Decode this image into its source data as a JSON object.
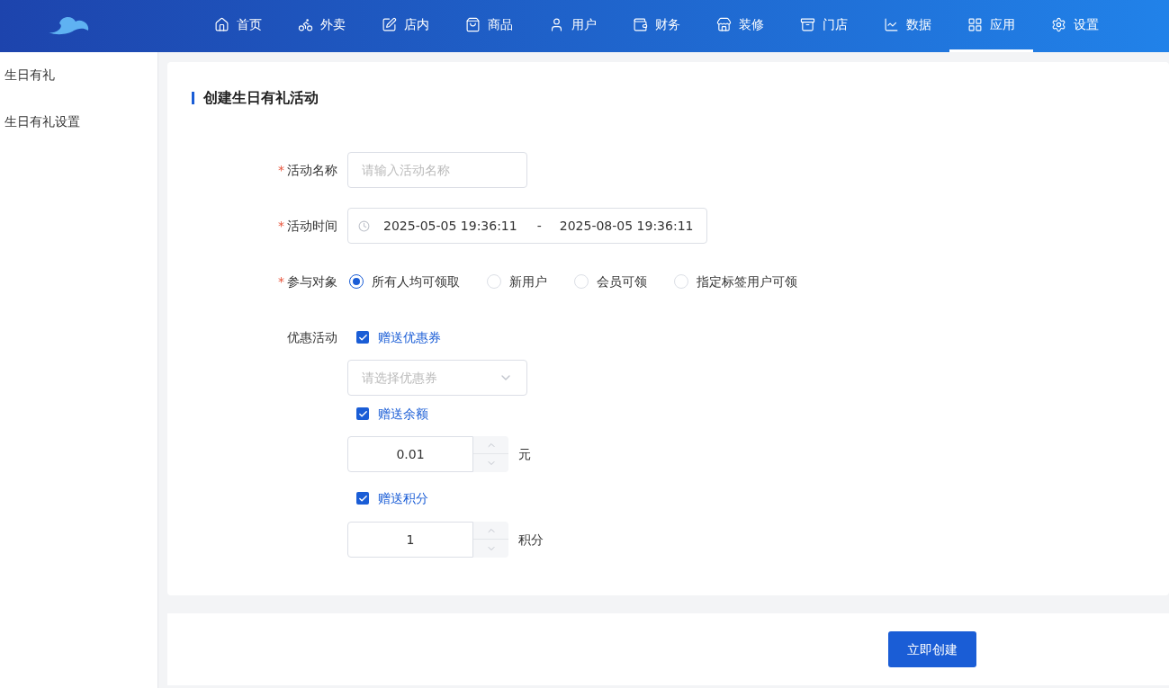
{
  "nav": {
    "items": [
      {
        "label": "首页",
        "selected": false
      },
      {
        "label": "外卖",
        "selected": false
      },
      {
        "label": "店内",
        "selected": false
      },
      {
        "label": "商品",
        "selected": false
      },
      {
        "label": "用户",
        "selected": false
      },
      {
        "label": "财务",
        "selected": false
      },
      {
        "label": "装修",
        "selected": false
      },
      {
        "label": "门店",
        "selected": false
      },
      {
        "label": "数据",
        "selected": false
      },
      {
        "label": "应用",
        "selected": true
      },
      {
        "label": "设置",
        "selected": false
      }
    ]
  },
  "sidebar": {
    "items": [
      {
        "label": "生日有礼"
      },
      {
        "label": "生日有礼设置"
      }
    ]
  },
  "form": {
    "title": "创建生日有礼活动",
    "fields": [
      {
        "kind": "text",
        "required_mark": "*",
        "label": "活动名称",
        "placeholder": "请输入活动名称"
      },
      {
        "kind": "date_range",
        "required_mark": "*",
        "label": "活动时间",
        "start": "2025-05-05 19:36:11",
        "separator": "-",
        "end": "2025-08-05 19:36:11"
      },
      {
        "kind": "radio",
        "required_mark": "*",
        "label": "参与对象",
        "options": [
          {
            "label": "所有人均可领取",
            "selected": true
          },
          {
            "label": "新用户",
            "selected": false
          },
          {
            "label": "会员可领",
            "selected": false
          },
          {
            "label": "指定标签用户可领",
            "selected": false
          }
        ]
      },
      {
        "kind": "benefits",
        "label": "优惠活动",
        "items": [
          {
            "kind": "select",
            "label": "赠送优惠券",
            "checked": true,
            "placeholder": "请选择优惠券"
          },
          {
            "kind": "number",
            "label": "赠送余额",
            "checked": true,
            "value": "0.01",
            "unit": "元"
          },
          {
            "kind": "number",
            "label": "赠送积分",
            "checked": true,
            "value": "1",
            "unit": "积分"
          }
        ]
      }
    ]
  },
  "submit": "立即创建"
}
